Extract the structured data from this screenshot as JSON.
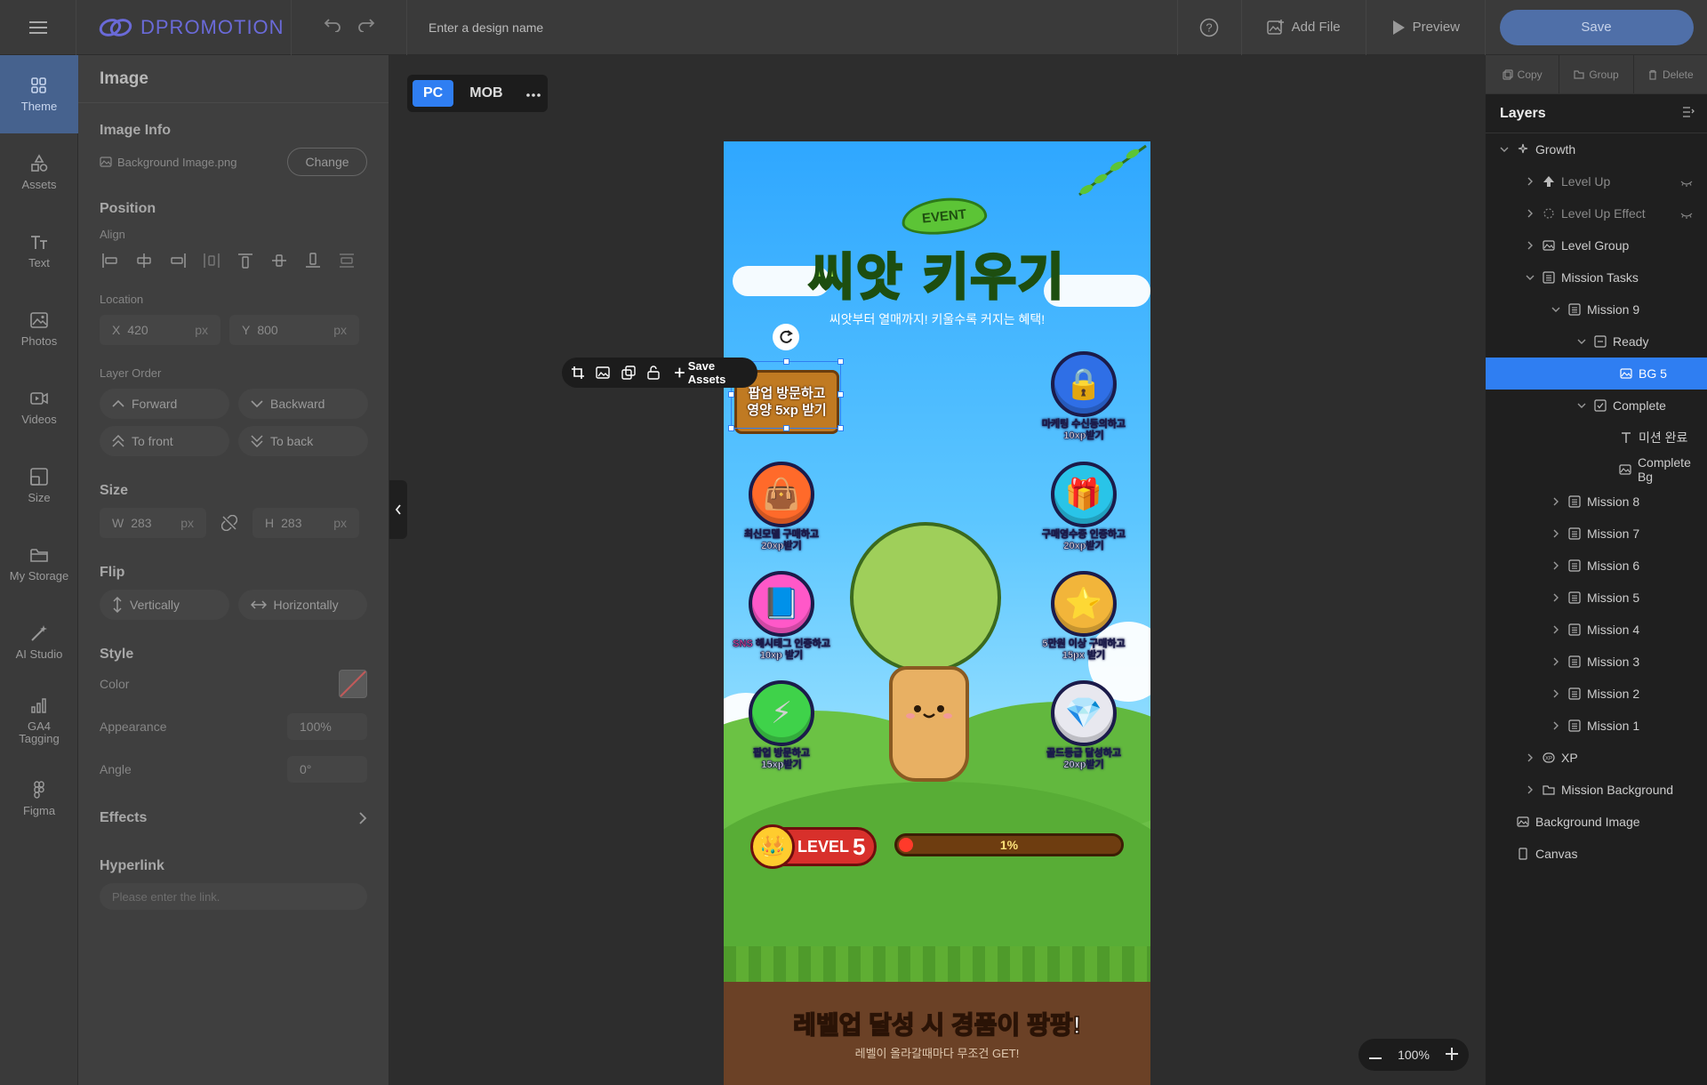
{
  "topbar": {
    "logo": "DPROMOTION",
    "design_name_placeholder": "Enter a design name",
    "add_file": "Add File",
    "preview": "Preview",
    "save": "Save"
  },
  "rail": [
    {
      "label": "Theme",
      "icon": "theme-icon"
    },
    {
      "label": "Assets",
      "icon": "assets-icon"
    },
    {
      "label": "Text",
      "icon": "text-icon"
    },
    {
      "label": "Photos",
      "icon": "photos-icon"
    },
    {
      "label": "Videos",
      "icon": "videos-icon"
    },
    {
      "label": "Size",
      "icon": "size-icon"
    },
    {
      "label": "My Storage",
      "icon": "folder-icon"
    },
    {
      "label": "AI Studio",
      "icon": "ai-wand-icon"
    },
    {
      "label": "GA4 Tagging",
      "icon": "analytics-icon"
    },
    {
      "label": "Figma",
      "icon": "figma-icon"
    }
  ],
  "props": {
    "title": "Image",
    "image_info": {
      "title": "Image Info",
      "file": "Background Image.png",
      "change": "Change"
    },
    "position": {
      "title": "Position",
      "align_label": "Align",
      "location_label": "Location",
      "x_label": "X",
      "x": "420",
      "y_label": "Y",
      "y": "800",
      "unit": "px",
      "layer_order_label": "Layer Order",
      "forward": "Forward",
      "backward": "Backward",
      "to_front": "To front",
      "to_back": "To back"
    },
    "size": {
      "title": "Size",
      "w_label": "W",
      "w": "283",
      "h_label": "H",
      "h": "283",
      "unit": "px"
    },
    "flip": {
      "title": "Flip",
      "vertically": "Vertically",
      "horizontally": "Horizontally"
    },
    "style": {
      "title": "Style",
      "color_label": "Color",
      "appearance_label": "Appearance",
      "appearance": "100%",
      "angle_label": "Angle",
      "angle": "0°"
    },
    "effects": {
      "title": "Effects"
    },
    "hyperlink": {
      "title": "Hyperlink",
      "placeholder": "Please enter the link."
    }
  },
  "canvas": {
    "device_pc": "PC",
    "device_mob": "MOB",
    "event_tag": "EVENT",
    "hero_title": "씨앗 키우기",
    "hero_sub": "씨앗부터 열매까지! 키울수록 커지는 혜택!",
    "popup_line1": "팝업 방문하고",
    "popup_line2": "영양 5xp 받기",
    "save_assets": "Save Assets",
    "missions": [
      {
        "l1": "마케팅 수신동의하고",
        "l2": "10xp받기",
        "emoji": "🔒",
        "color": "#2f6fe6"
      },
      {
        "l1": "최신모델 구매하고",
        "l2": "20xp받기",
        "emoji": "👜",
        "color": "#ff6a2a"
      },
      {
        "l1": "구매영수증 인증하고",
        "l2": "20xp받기",
        "emoji": "🎁",
        "color": "#29c4e8"
      },
      {
        "l1": "SNS 해시태그 인증하고",
        "l2": "10xp 받기",
        "emoji": "📘",
        "color": "#ff58c8"
      },
      {
        "l1": "5만원 이상 구매하고",
        "l2": "15px 받기",
        "emoji": "⭐",
        "color": "#f2b53a"
      },
      {
        "l1": "팝업 방문하고",
        "l2": "15xp받기",
        "emoji": "⚡",
        "color": "#3fd24a"
      },
      {
        "l1": "골드등급 달성하고",
        "l2": "20xp받기",
        "emoji": "💎",
        "color": "#e8e8ef"
      }
    ],
    "level_label": "LEVEL",
    "level_num": "5",
    "progress_text": "1%",
    "progress_value": 0.01,
    "bottom_title_hl": "레벨업",
    "bottom_title_rest": " 달성 시 경품이 팡팡!",
    "bottom_sub": "레벨이 올라갈때마다 무조건 GET!",
    "zoom": "100%"
  },
  "layers": {
    "copy": "Copy",
    "group": "Group",
    "delete": "Delete",
    "title": "Layers",
    "rows": [
      {
        "label": "Growth",
        "depth": 0,
        "chev": "down",
        "icon": "sparkle-icon"
      },
      {
        "label": "Level Up",
        "depth": 1,
        "chev": "right",
        "icon": "arrow-up-icon",
        "hidden": true
      },
      {
        "label": "Level Up Effect",
        "depth": 1,
        "chev": "right",
        "icon": "effect-icon",
        "hidden": true
      },
      {
        "label": "Level Group",
        "depth": 1,
        "chev": "right",
        "icon": "image-icon"
      },
      {
        "label": "Mission Tasks",
        "depth": 1,
        "chev": "down",
        "icon": "list-icon"
      },
      {
        "label": "Mission 9",
        "depth": 2,
        "chev": "down",
        "icon": "list-icon"
      },
      {
        "label": "Ready",
        "depth": 3,
        "chev": "down",
        "icon": "frame-icon"
      },
      {
        "label": "BG 5",
        "depth": 4,
        "chev": "",
        "icon": "image-icon",
        "selected": true
      },
      {
        "label": "Complete",
        "depth": 3,
        "chev": "down",
        "icon": "checkbox-icon"
      },
      {
        "label": "미션 완료",
        "depth": 4,
        "chev": "",
        "icon": "text-icon"
      },
      {
        "label": "Complete Bg",
        "depth": 4,
        "chev": "",
        "icon": "image-icon"
      },
      {
        "label": "Mission 8",
        "depth": 2,
        "chev": "right",
        "icon": "list-icon"
      },
      {
        "label": "Mission 7",
        "depth": 2,
        "chev": "right",
        "icon": "list-icon"
      },
      {
        "label": "Mission 6",
        "depth": 2,
        "chev": "right",
        "icon": "list-icon"
      },
      {
        "label": "Mission 5",
        "depth": 2,
        "chev": "right",
        "icon": "list-icon"
      },
      {
        "label": "Mission 4",
        "depth": 2,
        "chev": "right",
        "icon": "list-icon"
      },
      {
        "label": "Mission 3",
        "depth": 2,
        "chev": "right",
        "icon": "list-icon"
      },
      {
        "label": "Mission 2",
        "depth": 2,
        "chev": "right",
        "icon": "list-icon"
      },
      {
        "label": "Mission 1",
        "depth": 2,
        "chev": "right",
        "icon": "list-icon"
      },
      {
        "label": "XP",
        "depth": 1,
        "chev": "right",
        "icon": "xp-icon"
      },
      {
        "label": "Mission Background",
        "depth": 1,
        "chev": "right",
        "icon": "folder-icon"
      },
      {
        "label": "Background Image",
        "depth": 0,
        "chev": "",
        "icon": "image-icon"
      },
      {
        "label": "Canvas",
        "depth": 0,
        "chev": "",
        "icon": "canvas-icon"
      }
    ]
  },
  "colors": {
    "accent": "#2f7ef2",
    "save": "#4f6fa8",
    "active_rail": "#46628e"
  }
}
